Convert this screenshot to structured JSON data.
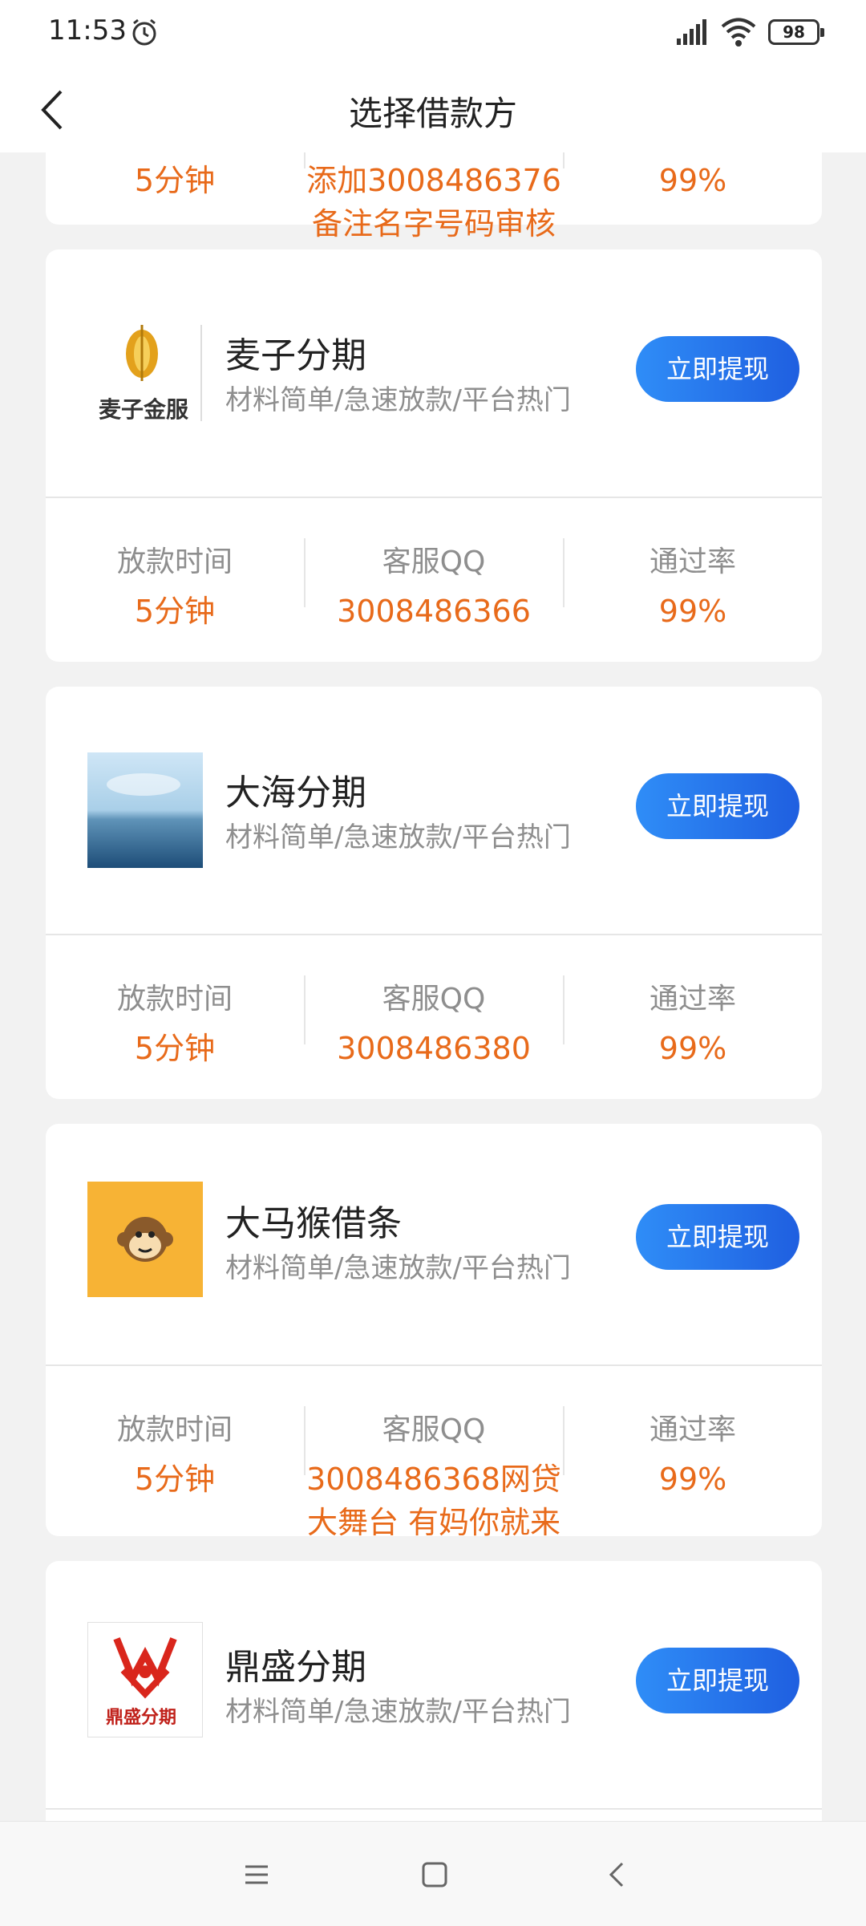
{
  "status_bar": {
    "time": "11:53",
    "battery": "98"
  },
  "header": {
    "title": "选择借款方",
    "back_icon": "chevron-left-icon"
  },
  "partial_card": {
    "time_value": "5分钟",
    "qq_value_line1": "添加3008486376",
    "qq_value_line2": "备注名字号码审核",
    "rate_value": "99%"
  },
  "labels": {
    "time": "放款时间",
    "qq": "客服QQ",
    "rate": "通过率"
  },
  "lenders": [
    {
      "name": "麦子分期",
      "desc": "材料简单/急速放款/平台热门",
      "button": "立即提现",
      "logo": "wheat-logo-icon",
      "logo_text": "麦子金服",
      "time_value": "5分钟",
      "qq_value": "3008486366",
      "rate_value": "99%"
    },
    {
      "name": "大海分期",
      "desc": "材料简单/急速放款/平台热门",
      "button": "立即提现",
      "logo": "sea-image-icon",
      "time_value": "5分钟",
      "qq_value": "3008486380",
      "rate_value": "99%"
    },
    {
      "name": "大马猴借条",
      "desc": "材料简单/急速放款/平台热门",
      "button": "立即提现",
      "logo": "monkey-logo-icon",
      "time_value": "5分钟",
      "qq_value_line1": "3008486368网贷",
      "qq_value_line2": "大舞台 有妈你就来",
      "rate_value": "99%"
    },
    {
      "name": "鼎盛分期",
      "desc": "材料简单/急速放款/平台热门",
      "button": "立即提现",
      "logo": "dingsheng-logo-icon",
      "logo_text": "鼎盛分期"
    }
  ],
  "system_nav": {
    "menu_icon": "menu-icon",
    "home_icon": "home-icon",
    "back_icon": "back-icon"
  },
  "colors": {
    "accent_orange": "#e86a1a",
    "button_blue": "#1f6fe8",
    "monkey_bg": "#f7b335",
    "logo_red": "#d9261c"
  }
}
